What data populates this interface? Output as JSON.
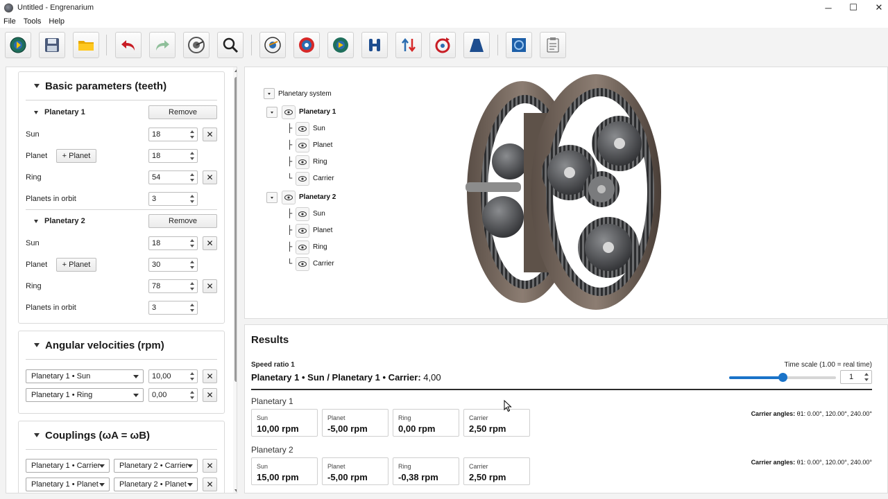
{
  "window": {
    "title": "Untitled - Engrenarium",
    "controls": {
      "minimize": "─",
      "maximize": "☐",
      "close": "✕"
    }
  },
  "menu": [
    "File",
    "Tools",
    "Help"
  ],
  "toolbar": {
    "buttons": [
      {
        "name": "new-icon"
      },
      {
        "name": "save-icon"
      },
      {
        "name": "open-folder-icon"
      },
      {
        "name": "undo-icon"
      },
      {
        "name": "redo-icon"
      },
      {
        "name": "view-gear-icon"
      },
      {
        "name": "zoom-icon"
      },
      {
        "name": "sun-gear-icon"
      },
      {
        "name": "ring-gear-icon"
      },
      {
        "name": "planet-gear-icon"
      },
      {
        "name": "coupling-icon"
      },
      {
        "name": "swap-arrows-icon"
      },
      {
        "name": "rotation-icon"
      },
      {
        "name": "profile-icon"
      },
      {
        "name": "settings-icon"
      },
      {
        "name": "clipboard-icon"
      }
    ]
  },
  "basic": {
    "title": "Basic parameters (teeth)",
    "planetary1": {
      "title": "Planetary 1",
      "remove_label": "Remove",
      "sun_label": "Sun",
      "sun_value": "18",
      "planet_label": "Planet",
      "add_planet_label": "+ Planet",
      "planet_value": "18",
      "ring_label": "Ring",
      "ring_value": "54",
      "orbit_label": "Planets in orbit",
      "orbit_value": "3"
    },
    "planetary2": {
      "title": "Planetary 2",
      "remove_label": "Remove",
      "sun_label": "Sun",
      "sun_value": "18",
      "planet_label": "Planet",
      "add_planet_label": "+ Planet",
      "planet_value": "30",
      "ring_label": "Ring",
      "ring_value": "78",
      "orbit_label": "Planets in orbit",
      "orbit_value": "3"
    }
  },
  "angular": {
    "title": "Angular velocities (rpm)",
    "rows": [
      {
        "member": "Planetary 1 • Sun",
        "value": "10,00"
      },
      {
        "member": "Planetary 1 • Ring",
        "value": "0,00"
      }
    ]
  },
  "couplings": {
    "title": "Couplings (ωA = ωB)",
    "rows": [
      {
        "a": "Planetary 1 • Carrier",
        "b": "Planetary 2 • Carrier"
      },
      {
        "a": "Planetary 1 • Planet",
        "b": "Planetary 2 • Planet"
      }
    ]
  },
  "tree": {
    "root": "Planetary system",
    "p1": {
      "label": "Planetary 1",
      "children": [
        "Sun",
        "Planet",
        "Ring",
        "Carrier"
      ]
    },
    "p2": {
      "label": "Planetary 2",
      "children": [
        "Sun",
        "Planet",
        "Ring",
        "Carrier"
      ]
    }
  },
  "results": {
    "title": "Results",
    "speed_caption": "Speed ratio 1",
    "speed_expr": "Planetary 1 • Sun / Planetary 1 • Carrier:",
    "speed_value": "4,00",
    "timescale_label": "Time scale (1.00 = real time)",
    "timescale_value": "1",
    "timescale_slider_fraction": 0.5,
    "p1": {
      "title": "Planetary 1",
      "cards": [
        {
          "label": "Sun",
          "value": "10,00 rpm"
        },
        {
          "label": "Planet",
          "value": "-5,00 rpm"
        },
        {
          "label": "Ring",
          "value": "0,00 rpm"
        },
        {
          "label": "Carrier",
          "value": "2,50 rpm"
        }
      ],
      "carrier_angles_label": "Carrier angles:",
      "carrier_angles_value": "θ1: 0.00°, 120.00°, 240.00°"
    },
    "p2": {
      "title": "Planetary 2",
      "cards": [
        {
          "label": "Sun",
          "value": "15,00 rpm"
        },
        {
          "label": "Planet",
          "value": "-5,00 rpm"
        },
        {
          "label": "Ring",
          "value": "-0,38 rpm"
        },
        {
          "label": "Carrier",
          "value": "2,50 rpm"
        }
      ],
      "carrier_angles_label": "Carrier angles:",
      "carrier_angles_value": "θ1: 0.00°, 120.00°, 240.00°"
    }
  }
}
